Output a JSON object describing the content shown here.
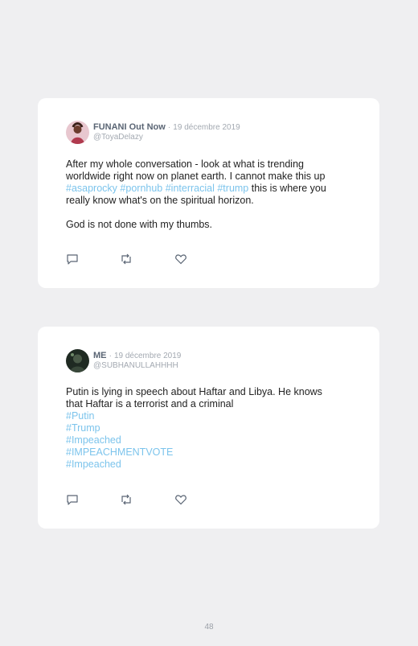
{
  "page_number": "48",
  "tweets": [
    {
      "display_name": "FUNANI Out Now",
      "separator": "·",
      "date": "19 décembre 2019",
      "handle": "@ToyaDelazy",
      "lines": [
        "After my whole conversation - look at what is trending",
        "worldwide right now on planet earth. I cannot make this up"
      ],
      "hashtags_inline": [
        "#asaprocky",
        "#pornhub",
        "#interracial",
        "#trump"
      ],
      "after_hashtags": " this is where you",
      "line_4": "really know what's on the spiritual horizon.",
      "line_5": "God is not done with my thumbs.",
      "icons": [
        "reply-icon",
        "retweet-icon",
        "like-icon"
      ]
    },
    {
      "display_name": "ME",
      "separator": "·",
      "date": "19 décembre 2019",
      "handle": "@SUBHANULLAHHHH",
      "lines": [
        "Putin is lying in speech about Haftar and Libya. He knows",
        "that Haftar is a terrorist and a criminal"
      ],
      "hashtags": [
        "#Putin",
        "#Trump",
        "#Impeached",
        "#IMPEACHMENTVOTE",
        "#Impeached"
      ],
      "icons": [
        "reply-icon",
        "retweet-icon",
        "like-icon"
      ]
    }
  ],
  "colors": {
    "background": "#efeff1",
    "card": "#ffffff",
    "hashtag": "#7cc4ec",
    "name": "#5a6574",
    "muted": "#a3a9b1"
  }
}
